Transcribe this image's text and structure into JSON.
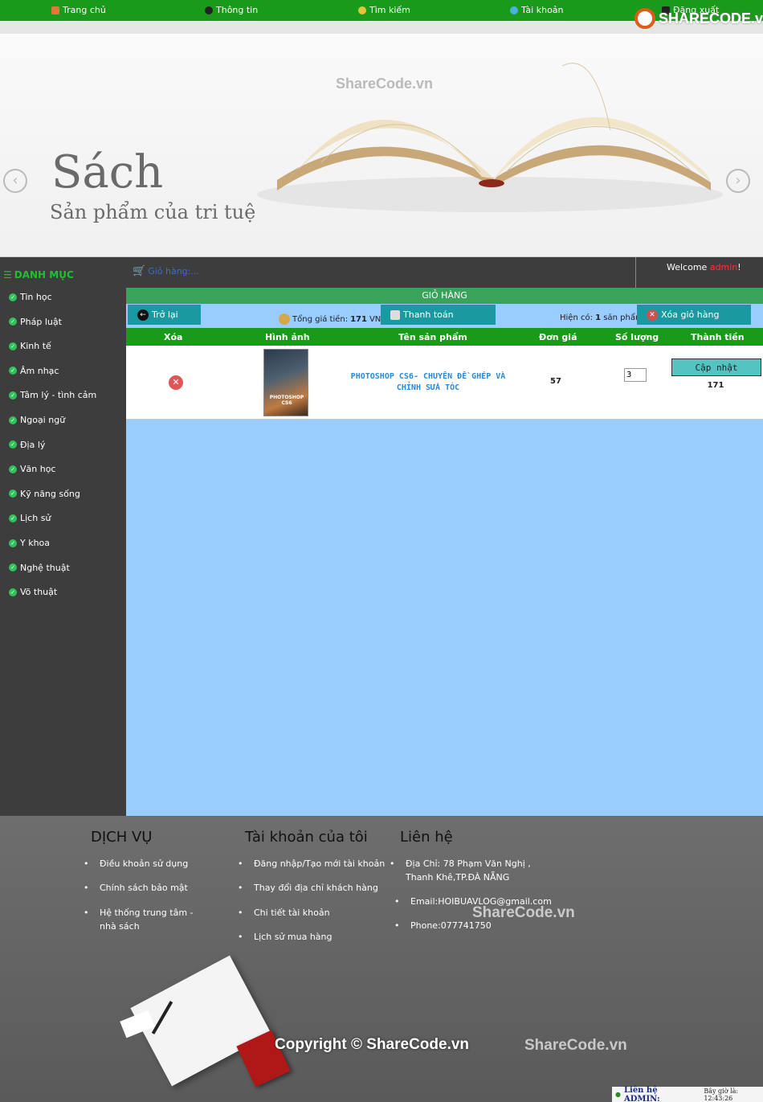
{
  "nav": {
    "home": "Trang chủ",
    "info": "Thông tin",
    "search": "Tìm kiếm",
    "account": "Tài khoản",
    "logout": "Đăng xuất"
  },
  "logo": {
    "text": "SHARECODE.vn"
  },
  "banner": {
    "title": "Sách",
    "subtitle": "Sản phẩm của tri tuệ",
    "watermark": "ShareCode.vn"
  },
  "sidebar": {
    "heading": "DANH MỤC",
    "items": [
      "Tin học",
      "Pháp luật",
      "Kinh tế",
      "Âm nhạc",
      "Tâm lý - tình cảm",
      "Ngoại ngữ",
      "Địa lý",
      "Văn học",
      "Kỹ năng sống",
      "Lịch sử",
      "Y khoa",
      "Nghệ thuật",
      "Võ thuật"
    ]
  },
  "cart_bar": {
    "cart_link": "Giỏ hàng:...",
    "welcome_prefix": "Welcome ",
    "username": "admin",
    "welcome_suffix": "!"
  },
  "cart": {
    "title": "GIỎ HÀNG",
    "back_label": "Trở lại",
    "total_prefix": "Tổng giá tiền: ",
    "total_value": "171",
    "total_unit": " VNĐ",
    "checkout_label": "Thanh toán",
    "count_prefix": "Hiện có: ",
    "count_value": "1",
    "count_suffix": " sản phẩm",
    "clear_label": "Xóa giỏ hàng",
    "columns": [
      "Xóa",
      "Hình ảnh",
      "Tên sản phẩm",
      "Đơn giá",
      "Số lượng",
      "Thành tiền"
    ],
    "rows": [
      {
        "cover_text": "PHOTOSHOP CS6",
        "name": "PHOTOSHOP CS6- CHUYÊN ĐỀ GHÉP VÀ CHỈNH SỬA TÓC",
        "price": "57",
        "quantity": "3",
        "update_label": "Cập nhật",
        "subtotal": "171"
      }
    ]
  },
  "footer": {
    "services_title": "DỊCH VỤ",
    "services": [
      "Điều khoản sử dụng",
      "Chính sách bảo mật",
      "Hệ thống trung tâm - nhà sách"
    ],
    "account_title": "Tài khoản của tôi",
    "account_links": [
      "Đăng nhập/Tạo mới tài khoản",
      "Thay đổi địa chỉ khách hàng",
      "Chi tiết tài khoản",
      "Lịch sử mua hàng"
    ],
    "contact_title": "Liên hệ",
    "contact": [
      "Địa Chỉ: 78 Phạm Văn Nghị , Thanh Khê,TP.ĐÀ NẴNG",
      "Email:HOIBUAVLOG@gmail.com",
      "Phone:077741750"
    ],
    "watermark1": "ShareCode.vn",
    "watermark2": "ShareCode.vn",
    "copyright": "Copyright © ShareCode.vn",
    "contact_admin": "Liên hệ ADMIN:",
    "clock": "Bây giờ là: 12:43:26"
  },
  "colors": {
    "nav_green": "#1a9a1a",
    "sidebar": "#3d3d3d",
    "main_bg": "#99ccff",
    "teal_button": "#1a9aa0"
  }
}
